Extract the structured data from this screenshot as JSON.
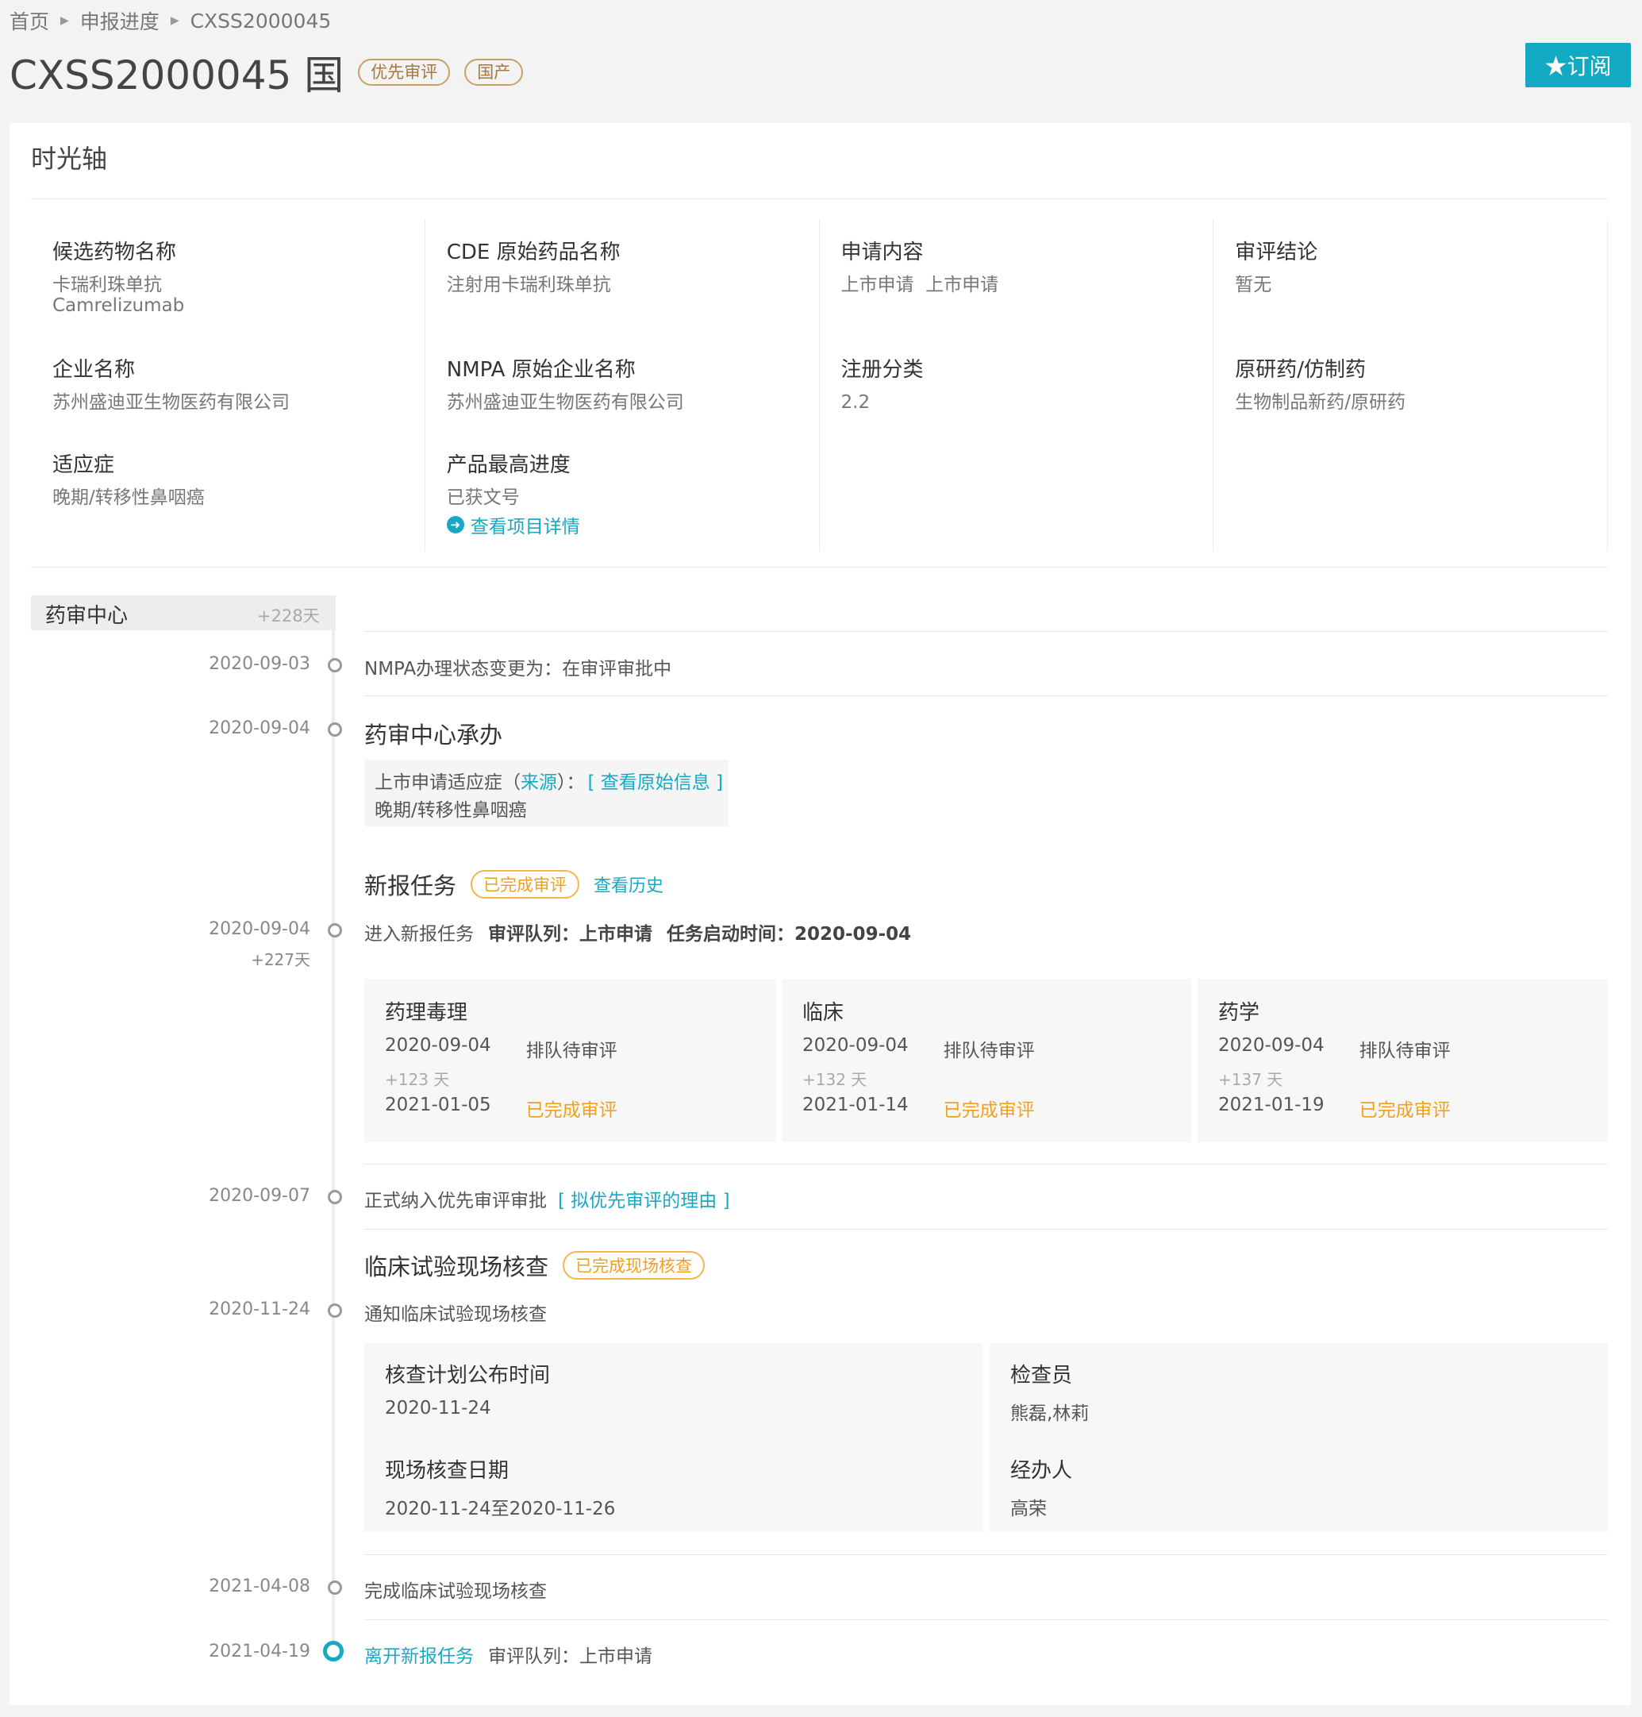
{
  "breadcrumb": [
    "首页",
    "申报进度",
    "CXSS2000045"
  ],
  "title": "CXSS2000045 国",
  "tags": [
    "优先审评",
    "国产"
  ],
  "subscribe_label": "★订阅",
  "card_title": "时光轴",
  "info": {
    "candidate_label": "候选药物名称",
    "candidate_cn": "卡瑞利珠单抗",
    "candidate_en": "Camrelizumab",
    "cde_label": "CDE 原始药品名称",
    "cde_val": "注射用卡瑞利珠单抗",
    "apply_label": "申请内容",
    "apply_val": "上市申请  上市申请",
    "conclusion_label": "审评结论",
    "conclusion_val": "暂无",
    "company_label": "企业名称",
    "company_val": "苏州盛迪亚生物医药有限公司",
    "nmpa_label": "NMPA 原始企业名称",
    "nmpa_val": "苏州盛迪亚生物医药有限公司",
    "reg_label": "注册分类",
    "reg_val": "2.2",
    "orig_label": "原研药/仿制药",
    "orig_val": "生物制品新药/原研药",
    "indication_label": "适应症",
    "indication_val": "晚期/转移性鼻咽癌",
    "progress_label": "产品最高进度",
    "progress_val": "已获文号",
    "detail_link": "查看项目详情"
  },
  "stage": {
    "name": "药审中心",
    "days": "+228天"
  },
  "timeline": {
    "e1": {
      "date": "2020-09-03",
      "text": "NMPA办理状态变更为：在审评审批中"
    },
    "e2": {
      "date": "2020-09-04",
      "heading": "药审中心承办",
      "box_prefix": "上市申请适应症（",
      "box_source": "来源",
      "box_mid": "）：",
      "box_link": "[ 查看原始信息 ]",
      "box_val": "晚期/转移性鼻咽癌"
    },
    "task": {
      "heading": "新报任务",
      "pill": "已完成审评",
      "history": "查看历史"
    },
    "e3": {
      "date": "2020-09-04",
      "days": "+227天",
      "text": "进入新报任务",
      "queue": "审评队列：上市申请",
      "start": "任务启动时间：2020-09-04"
    },
    "reviews": [
      {
        "name": "药理毒理",
        "start": "2020-09-04",
        "start_status": "排队待审评",
        "days": "+123 天",
        "end": "2021-01-05",
        "end_status": "已完成审评"
      },
      {
        "name": "临床",
        "start": "2020-09-04",
        "start_status": "排队待审评",
        "days": "+132 天",
        "end": "2021-01-14",
        "end_status": "已完成审评"
      },
      {
        "name": "药学",
        "start": "2020-09-04",
        "start_status": "排队待审评",
        "days": "+137 天",
        "end": "2021-01-19",
        "end_status": "已完成审评"
      }
    ],
    "e4": {
      "date": "2020-09-07",
      "text": "正式纳入优先审评审批",
      "link": "[ 拟优先审评的理由 ]"
    },
    "inspect": {
      "heading": "临床试验现场核查",
      "pill": "已完成现场核查"
    },
    "e5": {
      "date": "2020-11-24",
      "text": "通知临床试验现场核查"
    },
    "inspect_box": {
      "plan_label": "核查计划公布时间",
      "plan_val": "2020-11-24",
      "inspector_label": "检查员",
      "inspector_val": "熊磊,林莉",
      "site_label": "现场核查日期",
      "site_val": "2020-11-24至2020-11-26",
      "handler_label": "经办人",
      "handler_val": "高荣"
    },
    "e6": {
      "date": "2021-04-08",
      "text": "完成临床试验现场核查"
    },
    "e7": {
      "date": "2021-04-19",
      "link": "离开新报任务",
      "text": "审评队列：上市申请"
    }
  }
}
